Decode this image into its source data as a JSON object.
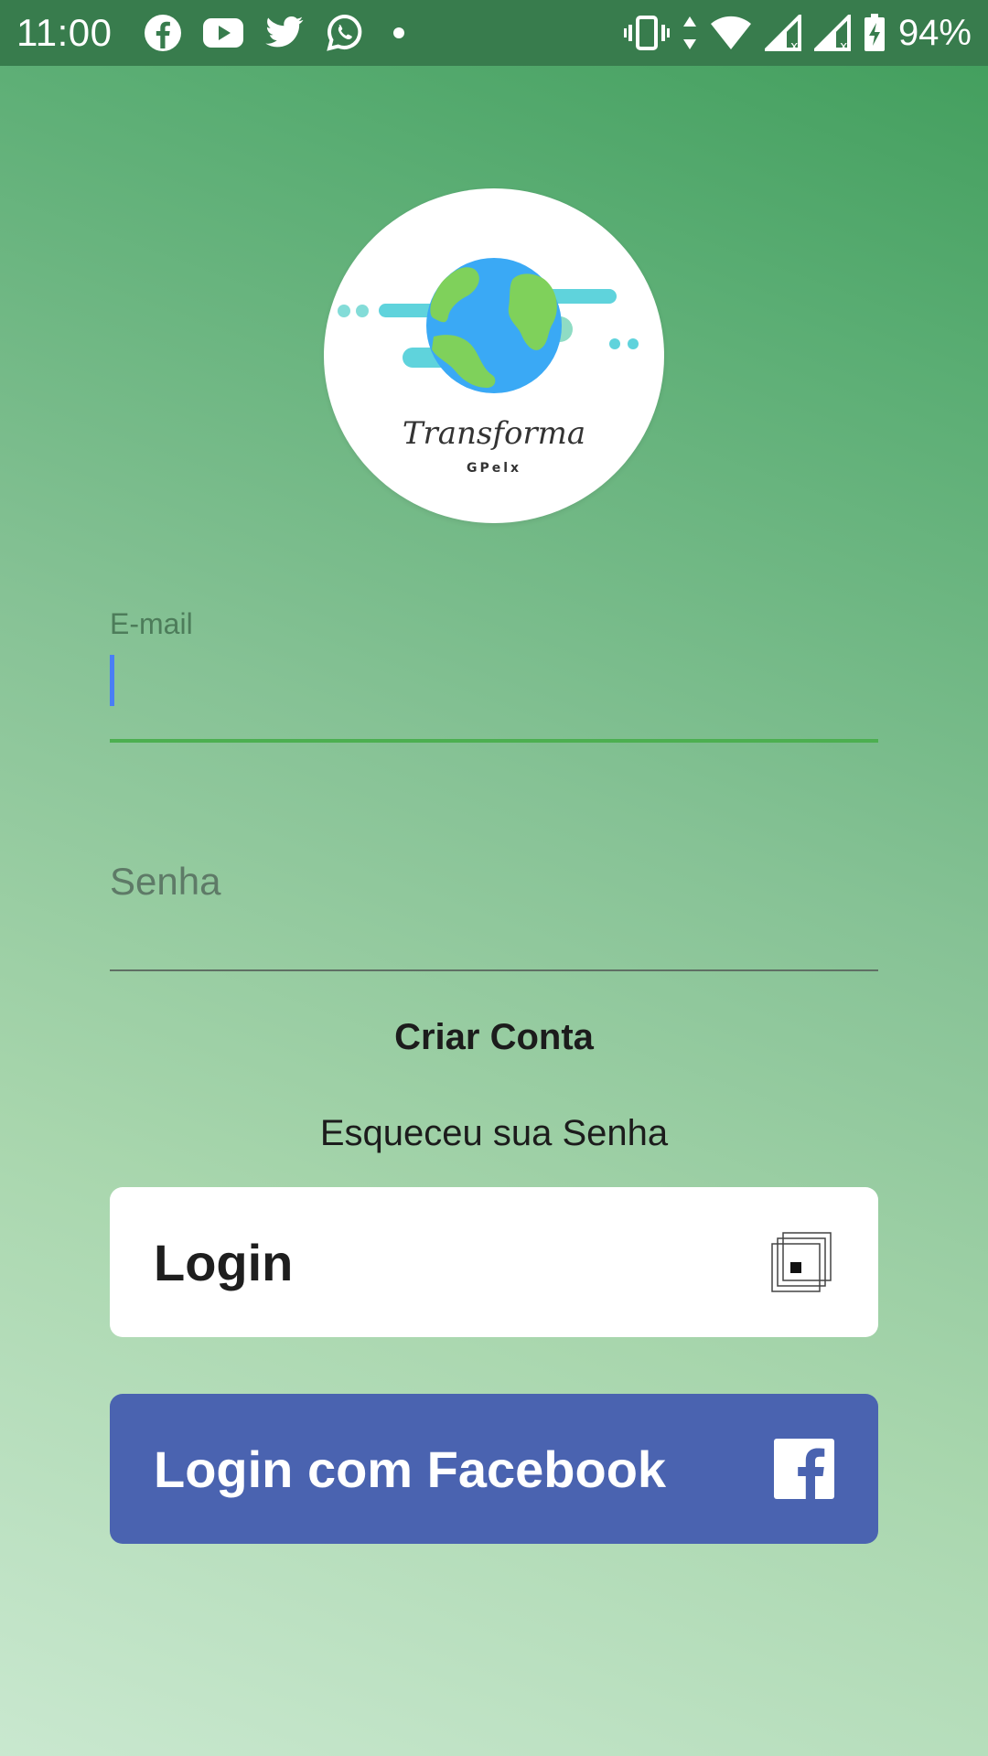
{
  "status_bar": {
    "time": "11:00",
    "battery_percent": "94%",
    "notification_icons": [
      "facebook-icon",
      "youtube-icon",
      "twitter-icon",
      "whatsapp-icon",
      "dot-icon"
    ],
    "system_icons": [
      "vibrate-icon",
      "data-arrows-icon",
      "wifi-icon",
      "signal-icon",
      "signal-icon",
      "battery-charging-icon"
    ],
    "background_color": "#387c4d"
  },
  "logo": {
    "brand_name": "Transforma",
    "brand_sub": "GPelx"
  },
  "form": {
    "email_label": "E-mail",
    "email_value": "",
    "password_placeholder": "Senha",
    "focus_color": "#4caf50",
    "caret_color": "#4a7ef5"
  },
  "links": {
    "create_account": "Criar Conta",
    "forgot_password": "Esqueceu sua Senha"
  },
  "buttons": {
    "login_label": "Login",
    "facebook_label": "Login com Facebook",
    "facebook_color": "#4a63b0"
  }
}
